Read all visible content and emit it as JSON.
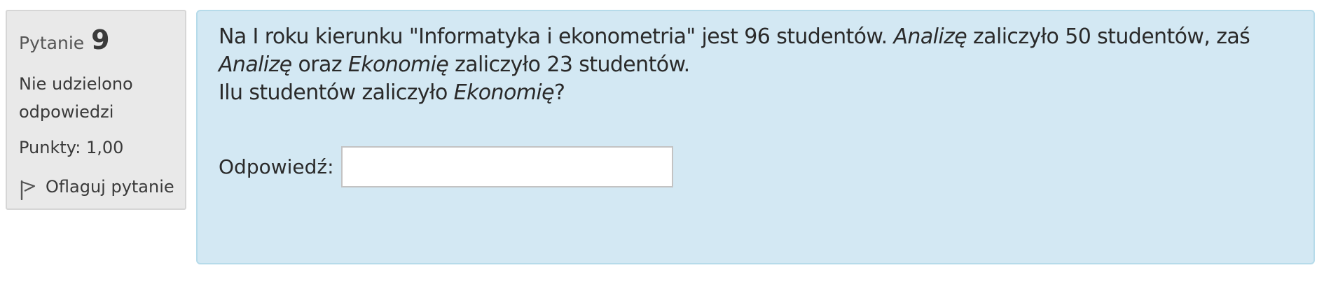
{
  "info": {
    "question_label": "Pytanie",
    "question_number": "9",
    "state": "Nie udzielono odpowiedzi",
    "grade": "Punkty: 1,00",
    "flag_label": "Oflaguj pytanie",
    "flag_icon": "flag-icon"
  },
  "question": {
    "seg1": "Na I roku kierunku \"Informatyka i ekonometria\" jest 96 studentów. ",
    "em1": "Analizę",
    "seg2": " zaliczyło 50 studentów, zaś ",
    "em2": "Analizę",
    "seg3": " oraz ",
    "em3": "Ekonomię",
    "seg4": " zaliczyło 23 studentów.",
    "seg5": "Ilu studentów zaliczyło ",
    "em4": "Ekonomię",
    "seg6": "?"
  },
  "answer": {
    "label": "Odpowiedź:",
    "value": ""
  }
}
